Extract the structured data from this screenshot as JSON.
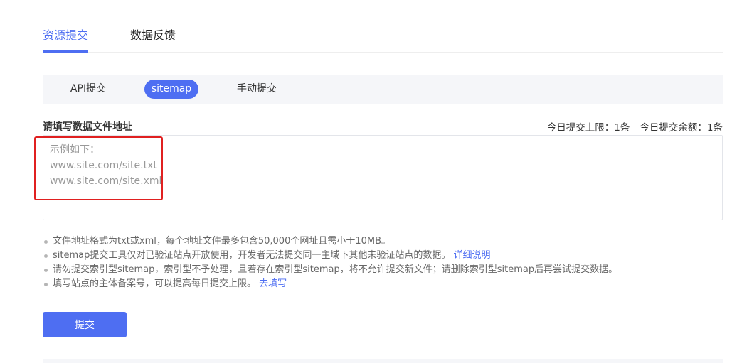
{
  "top_tabs": {
    "active": "资源提交",
    "inactive": "数据反馈"
  },
  "sub_tabs": {
    "api": "API提交",
    "sitemap": "sitemap",
    "manual": "手动提交",
    "selected": "sitemap"
  },
  "form": {
    "label": "请填写数据文件地址",
    "quota_limit": "今日提交上限：1条",
    "quota_remaining": "今日提交余额：1条",
    "value": "",
    "placeholder_lines": [
      "示例如下：",
      "www.site.com/site.txt",
      "www.site.com/site.xml"
    ]
  },
  "notes": [
    {
      "text": "文件地址格式为txt或xml，每个地址文件最多包含50,000个网址且需小于10MB。",
      "link": ""
    },
    {
      "text": "sitemap提交工具仅对已验证站点开放使用，开发者无法提交同一主域下其他未验证站点的数据。",
      "link": "详细说明"
    },
    {
      "text": "请勿提交索引型sitemap，索引型不予处理，且若存在索引型sitemap，将不允许提交新文件；请删除索引型sitemap后再尝试提交数据。",
      "link": ""
    },
    {
      "text": "填写站点的主体备案号，可以提高每日提交上限。",
      "link": "去填写"
    }
  ],
  "submit_label": "提交",
  "colors": {
    "accent": "#4e6ef2",
    "highlight": "#e02020",
    "bar_bg": "#f5f6f9"
  }
}
